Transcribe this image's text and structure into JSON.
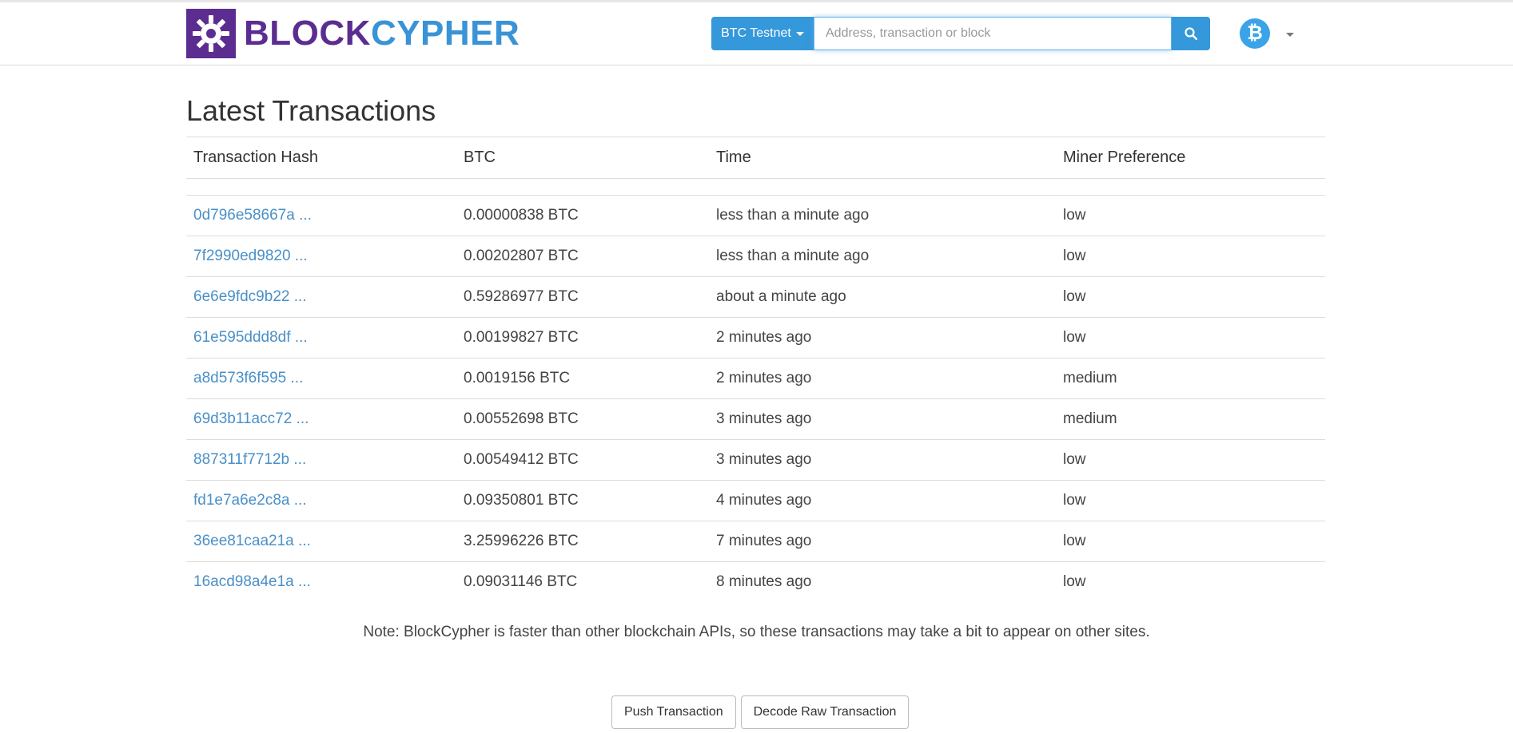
{
  "brand": {
    "part1": "BLOCK",
    "part2": "CYPHER"
  },
  "search": {
    "network_label": "BTC Testnet",
    "placeholder": "Address, transaction or block"
  },
  "page": {
    "title": "Latest Transactions"
  },
  "table": {
    "headers": [
      "Transaction Hash",
      "BTC",
      "Time",
      "Miner Preference"
    ],
    "rows": [
      {
        "hash": "0d796e58667a ...",
        "btc": "0.00000838 BTC",
        "time": "less than a minute ago",
        "pref": "low"
      },
      {
        "hash": "7f2990ed9820 ...",
        "btc": "0.00202807 BTC",
        "time": "less than a minute ago",
        "pref": "low"
      },
      {
        "hash": "6e6e9fdc9b22 ...",
        "btc": "0.59286977 BTC",
        "time": "about a minute ago",
        "pref": "low"
      },
      {
        "hash": "61e595ddd8df ...",
        "btc": "0.00199827 BTC",
        "time": "2 minutes ago",
        "pref": "low"
      },
      {
        "hash": "a8d573f6f595 ...",
        "btc": "0.0019156 BTC",
        "time": "2 minutes ago",
        "pref": "medium"
      },
      {
        "hash": "69d3b11acc72 ...",
        "btc": "0.00552698 BTC",
        "time": "3 minutes ago",
        "pref": "medium"
      },
      {
        "hash": "887311f7712b ...",
        "btc": "0.00549412 BTC",
        "time": "3 minutes ago",
        "pref": "low"
      },
      {
        "hash": "fd1e7a6e2c8a ...",
        "btc": "0.09350801 BTC",
        "time": "4 minutes ago",
        "pref": "low"
      },
      {
        "hash": "36ee81caa21a ...",
        "btc": "3.25996226 BTC",
        "time": "7 minutes ago",
        "pref": "low"
      },
      {
        "hash": "16acd98a4e1a ...",
        "btc": "0.09031146 BTC",
        "time": "8 minutes ago",
        "pref": "low"
      }
    ]
  },
  "note": "Note: BlockCypher is faster than other blockchain APIs, so these transactions may take a bit to appear on other sites.",
  "actions": {
    "push": "Push Transaction",
    "decode": "Decode Raw Transaction"
  },
  "colors": {
    "brand_purple": "#5c2d91",
    "brand_blue": "#3a93d6",
    "accent": "#3498db",
    "link": "#4a90c8"
  },
  "icons": {
    "logo": "gear-logo-icon",
    "search": "search-icon",
    "coin": "bitcoin-icon",
    "caret": "caret-down-icon"
  }
}
